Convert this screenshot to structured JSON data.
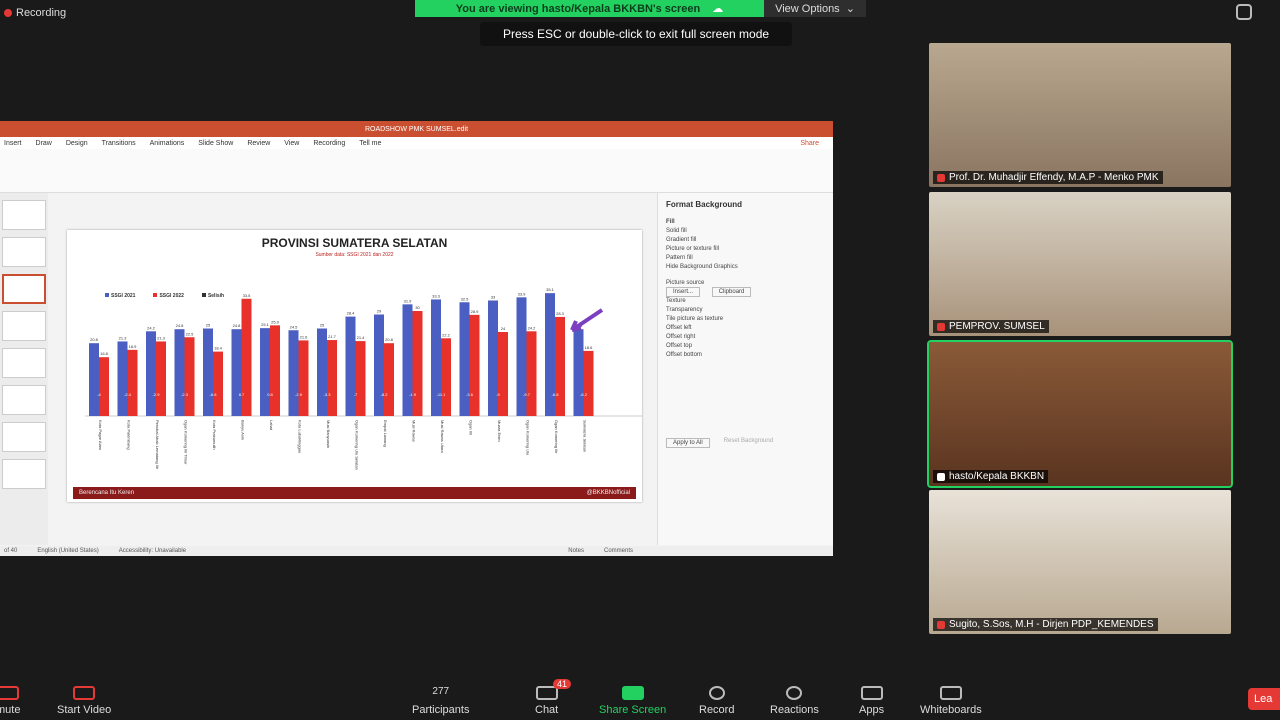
{
  "top": {
    "recording": "Recording",
    "viewing": "You are viewing hasto/Kepala BKKBN's screen",
    "view_options": "View Options",
    "esc_hint": "Press ESC or double-click to exit full screen mode"
  },
  "ppt": {
    "title": "ROADSHOW PMK SUMSEL.edit",
    "menu": [
      "Insert",
      "Draw",
      "Design",
      "Transitions",
      "Animations",
      "Slide Show",
      "Review",
      "View",
      "Recording",
      "Tell me"
    ],
    "share": "Share",
    "format_panel": {
      "title": "Format Background",
      "fill": "Fill",
      "options": [
        "Solid fill",
        "Gradient fill",
        "Picture or texture fill",
        "Pattern fill",
        "Hide Background Graphics"
      ],
      "picture_source": "Picture source",
      "insert": "Insert...",
      "clipboard": "Clipboard",
      "texture": "Texture",
      "transparency": "Transparency",
      "tile": "Tile picture as texture",
      "offsets": [
        "Offset left",
        "Offset right",
        "Offset top",
        "Offset bottom"
      ],
      "apply_all": "Apply to All",
      "reset": "Reset Background"
    },
    "status": [
      "of 40",
      "English (United States)",
      "Accessibility: Unavailable",
      "Notes",
      "Comments"
    ]
  },
  "slide": {
    "title": "PROVINSI SUMATERA SELATAN",
    "subtitle": "Sumber data: SSGI 2021 dan 2022",
    "footer_left": "Berencana Itu Keren",
    "footer_right": "@BKKBNofficial"
  },
  "chart_data": {
    "type": "bar",
    "categories": [
      "Kota Pagar Alam",
      "Kota Palembang",
      "Penukal Abab Lematang Ilir",
      "Ogan Komering Ilir Timur",
      "Kota Prabumulih",
      "Banyu Asin",
      "Lahat",
      "Kota Lubuklinggau",
      "Musi Banyuasin",
      "Ogan Komering Ulu Selatan",
      "Empat Lawang",
      "Musi Rawas",
      "Musi Rawas Utara",
      "Ogan Ilir",
      "Muara Enim",
      "Ogan Komering Ulu",
      "Ogan Komering Ilir",
      "Sumatera Selatan"
    ],
    "series": [
      {
        "name": "SSGI 2021",
        "color": "#4a5fc1",
        "values": [
          20.8,
          21.3,
          24.2,
          24.8,
          25.0,
          24.8,
          25.1,
          24.5,
          25.0,
          28.4,
          29.0,
          31.9,
          33.3,
          32.5,
          33.0,
          33.9,
          35.1,
          24.8
        ]
      },
      {
        "name": "SSGI 2022",
        "color": "#e8312a",
        "values": [
          16.8,
          18.9,
          21.3,
          22.5,
          18.4,
          33.5,
          25.9,
          21.6,
          21.7,
          21.4,
          20.8,
          30.0,
          22.2,
          28.9,
          24.0,
          24.2,
          28.3,
          18.6
        ]
      },
      {
        "name": "Selisih",
        "color": "#333333",
        "values": [
          -4.0,
          -2.4,
          -2.9,
          -2.3,
          -6.6,
          8.7,
          0.8,
          -2.9,
          -3.3,
          -7.0,
          -8.2,
          -1.9,
          -11.1,
          -3.6,
          -9.0,
          -9.7,
          -6.8,
          -6.2
        ]
      }
    ],
    "ylim": [
      0,
      40
    ]
  },
  "tiles": [
    {
      "name": "Prof. Dr. Muhadjir Effendy, M.A.P - Menko PMK"
    },
    {
      "name": "PEMPROV. SUMSEL"
    },
    {
      "name": "hasto/Kepala BKKBN"
    },
    {
      "name": "Sugito, S.Sos, M.H - Dirjen PDP_KEMENDES"
    }
  ],
  "toolbar": {
    "unmute": "mute",
    "start_video": "Start Video",
    "participants": "Participants",
    "participants_count": "277",
    "chat": "Chat",
    "chat_badge": "41",
    "share_screen": "Share Screen",
    "record": "Record",
    "reactions": "Reactions",
    "apps": "Apps",
    "whiteboards": "Whiteboards",
    "leave": "Lea"
  },
  "colors": {
    "zoom_green": "#23d160",
    "leave_red": "#e53935",
    "ppt_accent": "#c94f30"
  }
}
